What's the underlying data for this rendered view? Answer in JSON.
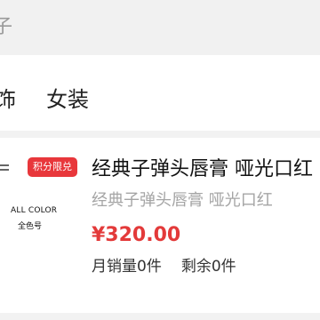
{
  "search": {
    "partial_text": "子"
  },
  "categories": [
    "饰",
    "女装"
  ],
  "product": {
    "badge": "积分限兑",
    "thumb_caption_en": "ALL COLOR",
    "thumb_caption_zh": "全色号",
    "title": "经典子弹头唇膏 哑光口红",
    "subtitle": "经典子弹头唇膏 哑光口红",
    "price": "¥320.00",
    "sold": "月销量0件",
    "remaining": "剩余0件"
  },
  "colors": {
    "price": "#e33a3a",
    "badge": "#e8373b"
  }
}
